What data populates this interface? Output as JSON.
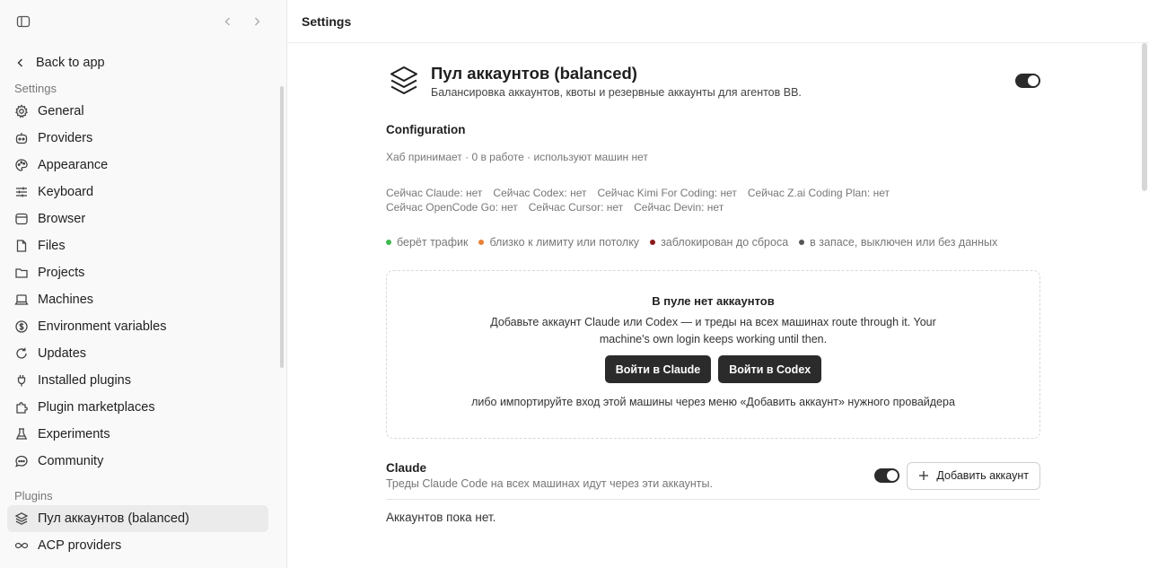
{
  "sidebar": {
    "back_label": "Back to app",
    "settings_label": "Settings",
    "items": [
      {
        "label": "General",
        "icon": "gear-icon"
      },
      {
        "label": "Providers",
        "icon": "bot-icon"
      },
      {
        "label": "Appearance",
        "icon": "palette-icon"
      },
      {
        "label": "Keyboard",
        "icon": "sliders-icon"
      },
      {
        "label": "Browser",
        "icon": "browser-icon"
      },
      {
        "label": "Files",
        "icon": "file-icon"
      },
      {
        "label": "Projects",
        "icon": "folder-icon"
      },
      {
        "label": "Machines",
        "icon": "laptop-icon"
      },
      {
        "label": "Environment variables",
        "icon": "dollar-circle-icon"
      },
      {
        "label": "Updates",
        "icon": "refresh-icon"
      },
      {
        "label": "Installed plugins",
        "icon": "plug-icon"
      },
      {
        "label": "Plugin marketplaces",
        "icon": "puzzle-icon"
      },
      {
        "label": "Experiments",
        "icon": "flask-icon"
      },
      {
        "label": "Community",
        "icon": "chat-icon"
      }
    ],
    "plugins_label": "Plugins",
    "plugin_items": [
      {
        "label": "Пул аккаунтов (balanced)",
        "icon": "layers-icon",
        "active": true
      },
      {
        "label": "ACP providers",
        "icon": "infinity-icon",
        "active": false
      }
    ]
  },
  "topbar": {
    "title": "Settings"
  },
  "plugin": {
    "title": "Пул аккаунтов (balanced)",
    "subtitle": "Балансировка аккаунтов, квоты и резервные аккаунты для агентов BB.",
    "enabled": true
  },
  "config": {
    "title": "Configuration",
    "status": "Хаб принимает · 0 в работе · используют машин нет",
    "now_line1": [
      "Сейчас Claude: нет",
      "Сейчас Codex: нет",
      "Сейчас Kimi For Coding: нет",
      "Сейчас Z.ai Coding Plan: нет"
    ],
    "now_line2": [
      "Сейчас OpenCode Go: нет",
      "Сейчас Cursor: нет",
      "Сейчас Devin: нет"
    ]
  },
  "legend": [
    {
      "label": "берёт трафик",
      "color": "#3fb950"
    },
    {
      "label": "близко к лимиту или потолку",
      "color": "#e8803a"
    },
    {
      "label": "заблокирован до сброса",
      "color": "#8b1a1a"
    },
    {
      "label": "в запасе, выключен или без данных",
      "color": "#555555"
    }
  ],
  "empty": {
    "title": "В пуле нет аккаунтов",
    "desc": "Добавьте аккаунт Claude или Codex — и треды на всех машинах route through it. Your machine's own login keeps working until then.",
    "btn_claude": "Войти в Claude",
    "btn_codex": "Войти в Codex",
    "foot": "либо импортируйте вход этой машины через меню «Добавить аккаунт» нужного провайдера"
  },
  "claude": {
    "title": "Claude",
    "subtitle": "Треды Claude Code на всех машинах идут через эти аккаунты.",
    "add_label": "Добавить аккаунт",
    "enabled": true,
    "empty_text": "Аккаунтов пока нет."
  }
}
